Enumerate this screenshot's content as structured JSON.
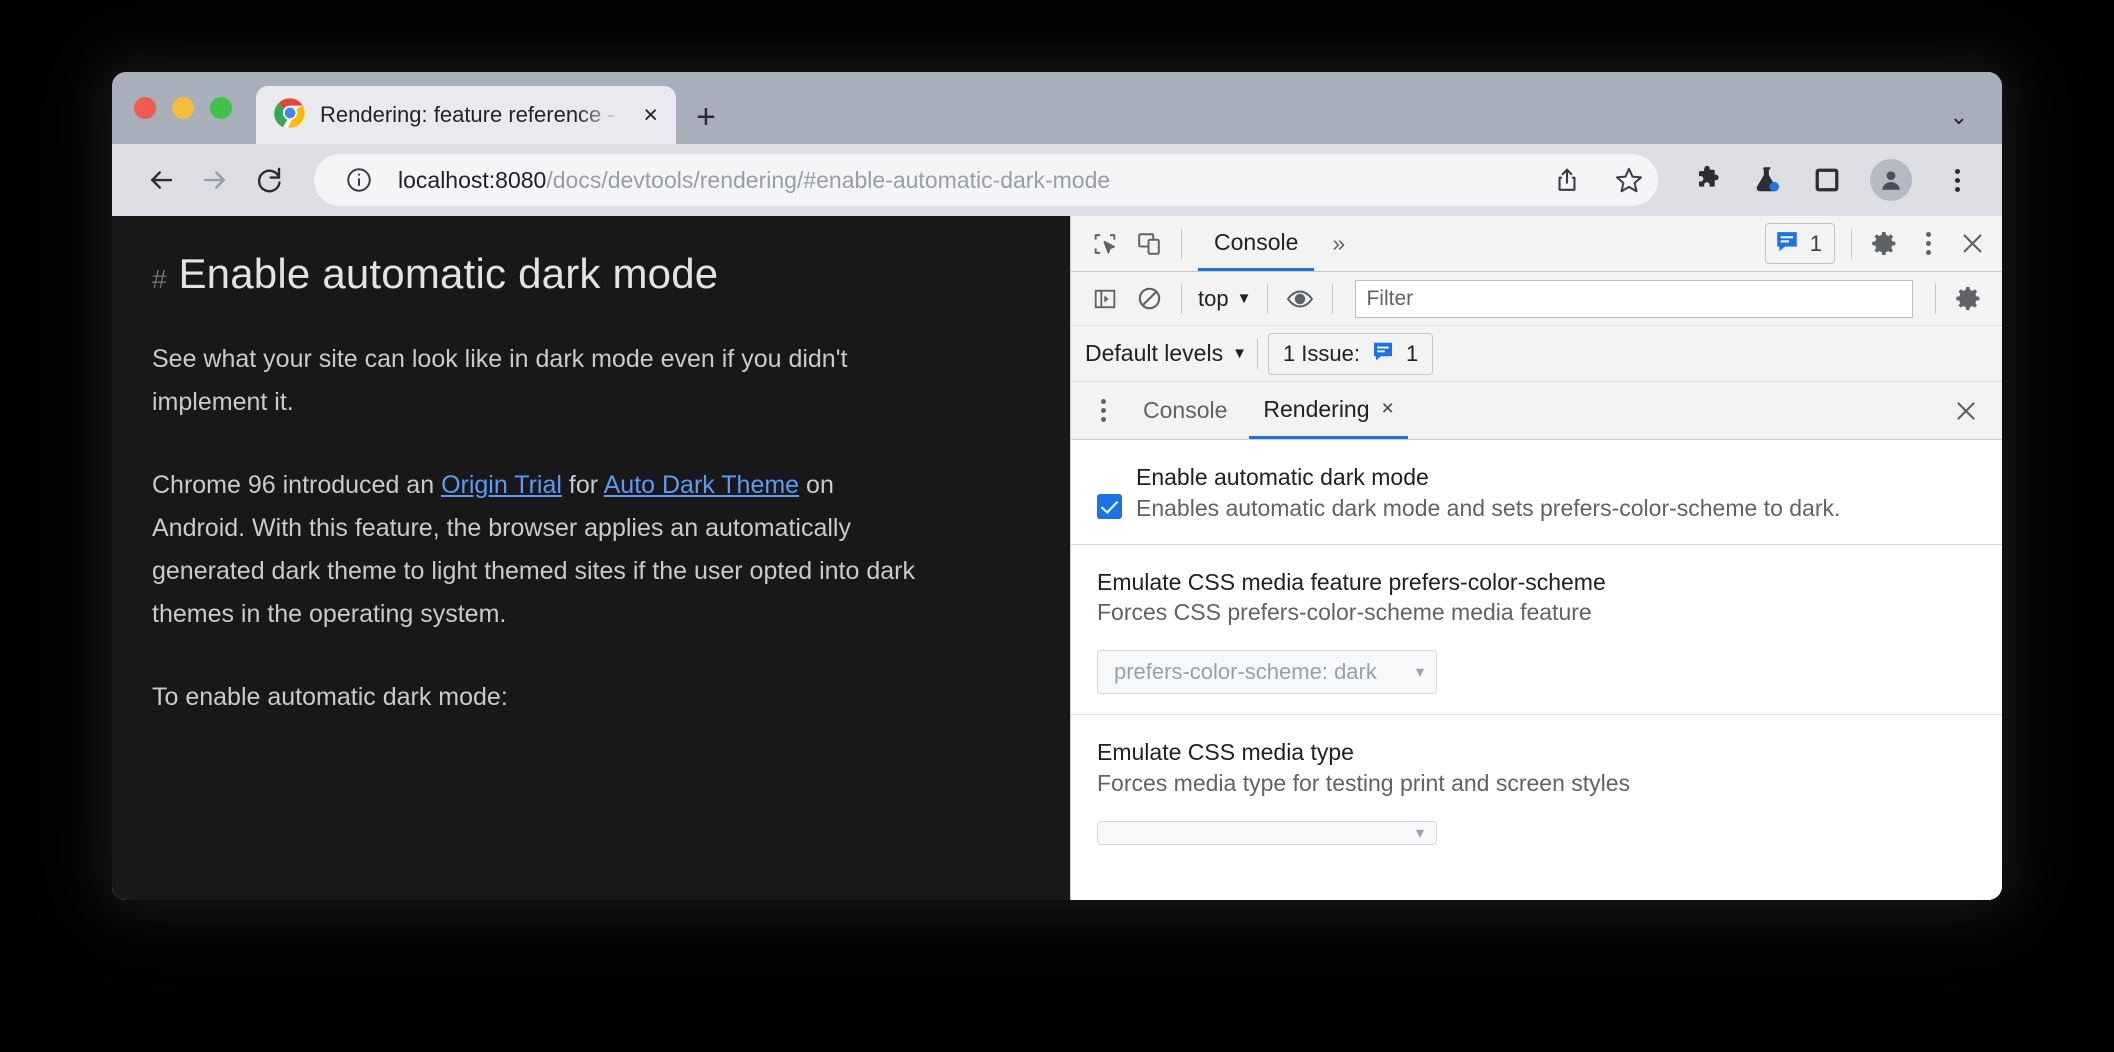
{
  "window": {
    "traffic_lights": [
      "close",
      "minimize",
      "zoom"
    ]
  },
  "tab_strip": {
    "active_tab_title": "Rendering: feature reference - ",
    "close_label": "×",
    "new_tab_label": "+",
    "tab_list_label": "⌄"
  },
  "toolbar": {
    "back_label": "←",
    "forward_label": "→",
    "reload_label": "↻",
    "url_host": "localhost:8080",
    "url_path": "/docs/devtools/rendering/#enable-automatic-dark-mode",
    "icons": {
      "site_info": "info-icon",
      "share": "share-icon",
      "bookmark": "star-icon",
      "extensions": "puzzle-icon",
      "experiments": "flask-icon",
      "side_panel": "side-panel-icon",
      "profile": "avatar-icon",
      "menu": "three-dot-menu-icon"
    }
  },
  "page": {
    "anchor": "#",
    "title": "Enable automatic dark mode",
    "paragraph1": "See what your site can look like in dark mode even if you didn't implement it.",
    "paragraph2": {
      "part1": "Chrome 96 introduced an ",
      "link1": "Origin Trial",
      "part2": " for ",
      "link2": "Auto Dark Theme",
      "part3": " on Android. With this feature, the browser applies an automatically generated dark theme to light themed sites if the user opted into dark themes in the operating system."
    },
    "paragraph3": "To enable automatic dark mode:"
  },
  "devtools": {
    "main_bar": {
      "inspect_icon": "inspect-element-icon",
      "device_icon": "device-toolbar-icon",
      "active_tab": "Console",
      "more_tabs": "»",
      "issues_count": "1",
      "settings_icon": "gear-icon",
      "menu_icon": "three-dot-menu-icon",
      "close_icon": "close-icon"
    },
    "console_bar": {
      "sidebar_icon": "console-sidebar-icon",
      "clear_icon": "clear-console-icon",
      "context": "top",
      "context_caret": "▼",
      "eye_icon": "live-expression-icon",
      "filter_placeholder": "Filter",
      "filter_value": "",
      "settings_icon": "gear-icon"
    },
    "levels_bar": {
      "levels": "Default levels",
      "levels_caret": "▼",
      "issue_label": "1 Issue:",
      "issue_count": "1"
    },
    "drawer": {
      "menu_icon": "three-dot-menu-icon",
      "tabs": [
        {
          "label": "Console",
          "active": false,
          "closable": false
        },
        {
          "label": "Rendering",
          "active": true,
          "closable": true,
          "close_label": "×"
        }
      ],
      "close_label": "×"
    },
    "rendering": {
      "sections": [
        {
          "title": "Enable automatic dark mode",
          "desc": "Enables automatic dark mode and sets prefers-color-scheme to dark.",
          "checkbox": true,
          "checked": true
        },
        {
          "title": "Emulate CSS media feature prefers-color-scheme",
          "desc": "Forces CSS prefers-color-scheme media feature",
          "select_value": "prefers-color-scheme: dark",
          "select_caret": "▾"
        },
        {
          "title": "Emulate CSS media type",
          "desc": "Forces media type for testing print and screen styles",
          "select_value": "",
          "select_caret": "▾"
        }
      ]
    }
  },
  "colors": {
    "accent": "#1a73e8",
    "page_background": "#181818",
    "page_text": "#c9cacb",
    "link": "#5b9bf8",
    "tab_strip": "#a9aebb",
    "toolbar": "#dcdee3",
    "devtools_bar": "#f3f3f3"
  }
}
